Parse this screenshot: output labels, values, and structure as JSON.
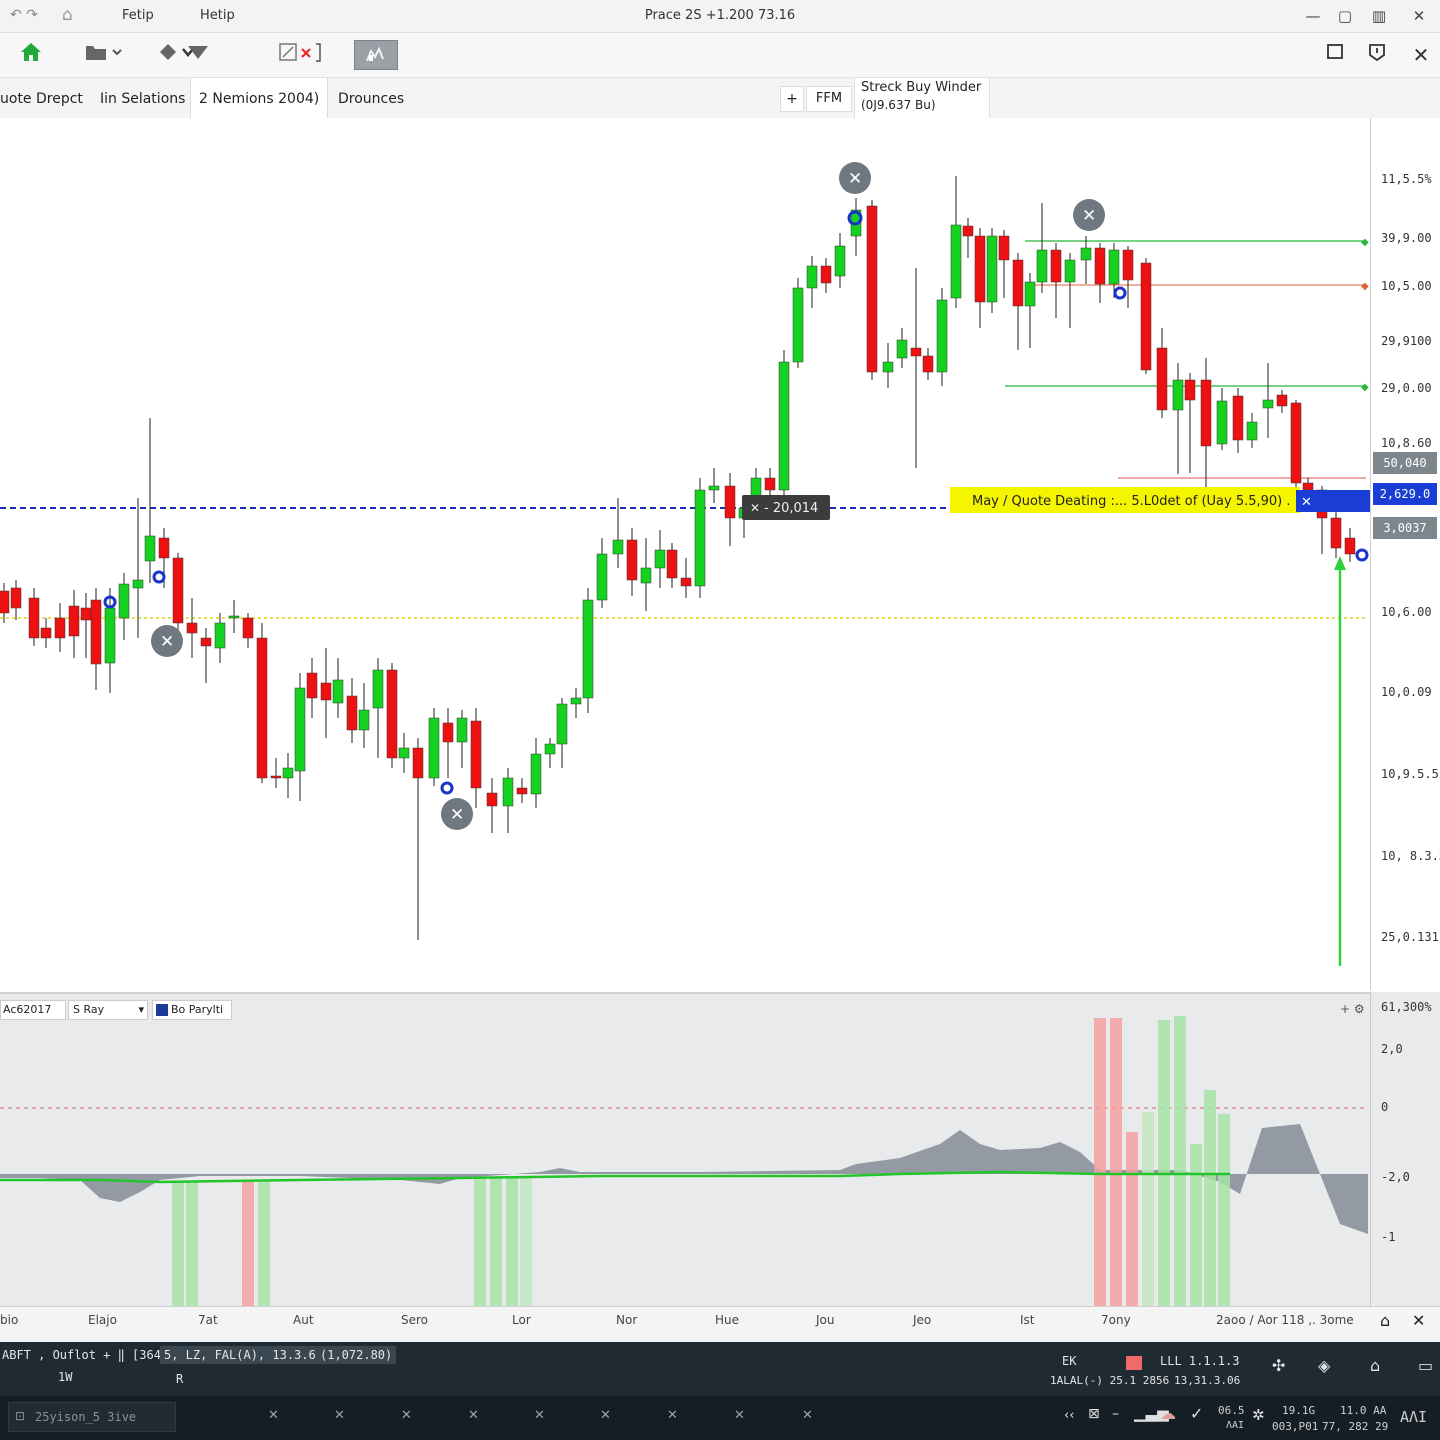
{
  "titlebar": {
    "menu": [
      "Fetip",
      "Hetip"
    ],
    "title": "Prace 2S +1.200 73.16",
    "controls": [
      "—",
      "▢",
      "▥",
      "✕"
    ]
  },
  "toolbar": {
    "icons": [
      "home-icon",
      "folder-icon",
      "drawing-tool-icon",
      "filter-icon",
      "close-chart-icon",
      "chart-type-icon",
      "window-icon",
      "camera-icon",
      "close-icon"
    ]
  },
  "tabs": [
    {
      "label": "uote Drepct"
    },
    {
      "label": "Iin Selations"
    },
    {
      "label": "2 Nemions 2004)"
    },
    {
      "label": "Drounces"
    }
  ],
  "tab_extra": {
    "add": "+",
    "ffm": "FFM",
    "strack_title": "Streck Buy Winder",
    "strack_sub": "(0J9.637 Bu)"
  },
  "price_axis": {
    "labels": [
      "11,5.5%",
      "39,9.00",
      "10,5.00",
      "29,9100",
      "29,0.00",
      "10,8.60",
      "10,6.00",
      "10,0.09",
      "10,9.5.5",
      "10, 8.3.5",
      "25,0.131"
    ],
    "badges": [
      {
        "text": "50,040",
        "color": "#7d868d"
      },
      {
        "text": "2,629.0",
        "color": "#1a3dd6"
      },
      {
        "text": "3,0037",
        "color": "#7d868d"
      }
    ]
  },
  "annotations": {
    "quote_banner": "May / Quote Deating :... 5.L0det of (Uay 5.5,90) .",
    "dark_tag": "- 20,014"
  },
  "colors": {
    "bull": "#14d21f",
    "bear": "#ee1111",
    "dashed_line": "#1a2dbd",
    "dotted_line": "#e8d200",
    "banner": "#f5f500",
    "indicator_fill": "#8a919c"
  },
  "indicator": {
    "selector_1": "Ac62017",
    "selector_2": "S Ray",
    "selector_3": "Bo Parylti",
    "axis_labels": [
      "61,300%",
      "2,0",
      "0",
      "-2,0",
      "-1"
    ]
  },
  "time_axis": {
    "labels": [
      "bio",
      "Elajo",
      "7at",
      "Aut",
      "Sero",
      "Lor",
      "Nor",
      "Hue",
      "Jou",
      "Jeo",
      "Ist",
      "7ony",
      "2aoo / Aor 118 ,. 3ome"
    ]
  },
  "status": {
    "left1": "ABFT , Ouflot + ‖ [3640]",
    "left2": "5, LZ, FAL(A), 13.3.6188",
    "left3": "(1,072.80)",
    "left1_sub": "1W",
    "left2_sub": "R",
    "mid_a_top": "EK",
    "mid_a_bottom": "1ALAL(-) 25.1 2856",
    "mid_b_top": "LLL   1.1.1.3",
    "mid_b_bottom": "13,31.3.06",
    "taskbar_search": "25yison_5 3ive",
    "tray_a_top": "06.5",
    "tray_a_bottom": "ΛΑΙ",
    "tray_b_top": "19.1G",
    "tray_b_bottom": "003,P01",
    "tray_c_top": "11.0 AA",
    "tray_c_bottom": "77, 282 29",
    "tray_d": "ΑΛΙ"
  }
}
